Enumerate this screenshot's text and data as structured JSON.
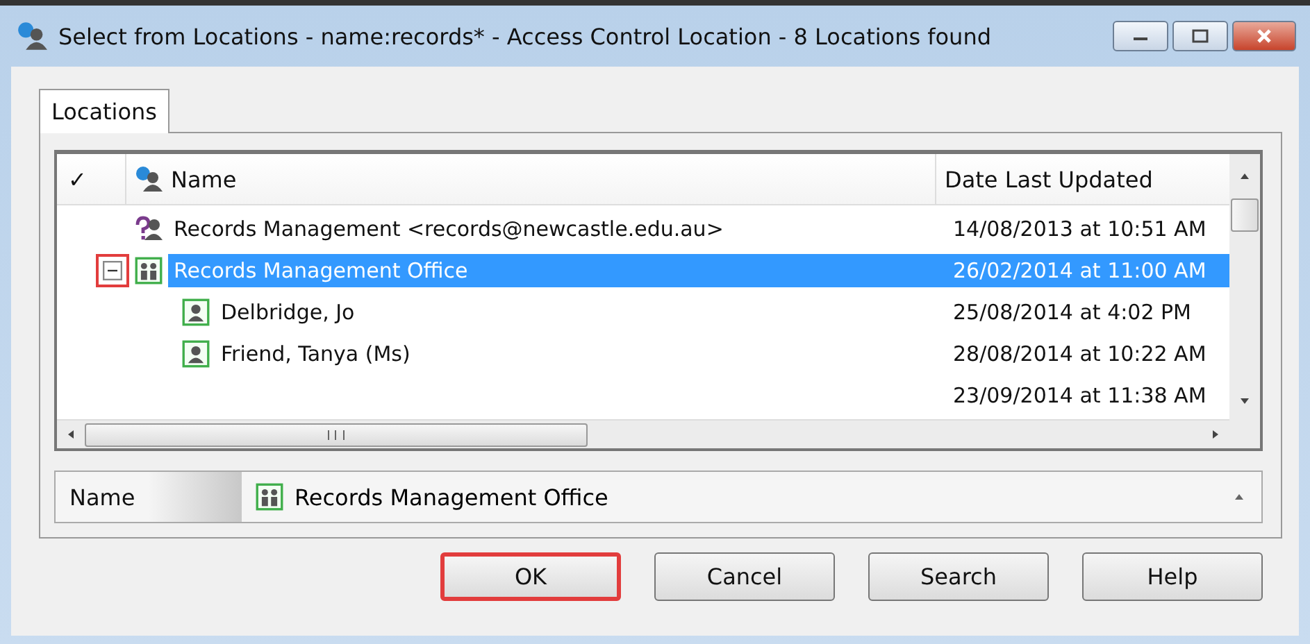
{
  "window": {
    "title": "Select from Locations - name:records* - Access Control Location - 8 Locations found"
  },
  "tabs": [
    {
      "label": "Locations",
      "selected": true
    }
  ],
  "list": {
    "columns": [
      {
        "kind": "check",
        "label": "✓"
      },
      {
        "kind": "name",
        "label": "Name"
      },
      {
        "kind": "date",
        "label": "Date Last Updated"
      }
    ],
    "rows": [
      {
        "kind": "contact",
        "name": "Records Management <records@newcastle.edu.au>",
        "date": "14/08/2013 at 10:51 AM",
        "selected": false
      },
      {
        "kind": "group",
        "name": "Records Management Office",
        "date": "26/02/2014 at 11:00 AM",
        "selected": true,
        "expanded": true,
        "highlighted": true,
        "children": [
          {
            "kind": "person",
            "name": "Delbridge, Jo",
            "date": "25/08/2014 at 4:02 PM",
            "selected": false
          },
          {
            "kind": "person",
            "name": "Friend, Tanya (Ms)",
            "date": "28/08/2014 at 10:22 AM",
            "selected": false
          }
        ]
      },
      {
        "kind": "blank",
        "date": "23/09/2014 at 11:38 AM",
        "selected": false
      }
    ]
  },
  "details": {
    "label": "Name",
    "kind": "group",
    "value": "Records Management Office"
  },
  "buttons": [
    {
      "label": "OK",
      "highlighted": true
    },
    {
      "label": "Cancel",
      "highlighted": false
    },
    {
      "label": "Search",
      "highlighted": false
    },
    {
      "label": "Help",
      "highlighted": false
    }
  ]
}
